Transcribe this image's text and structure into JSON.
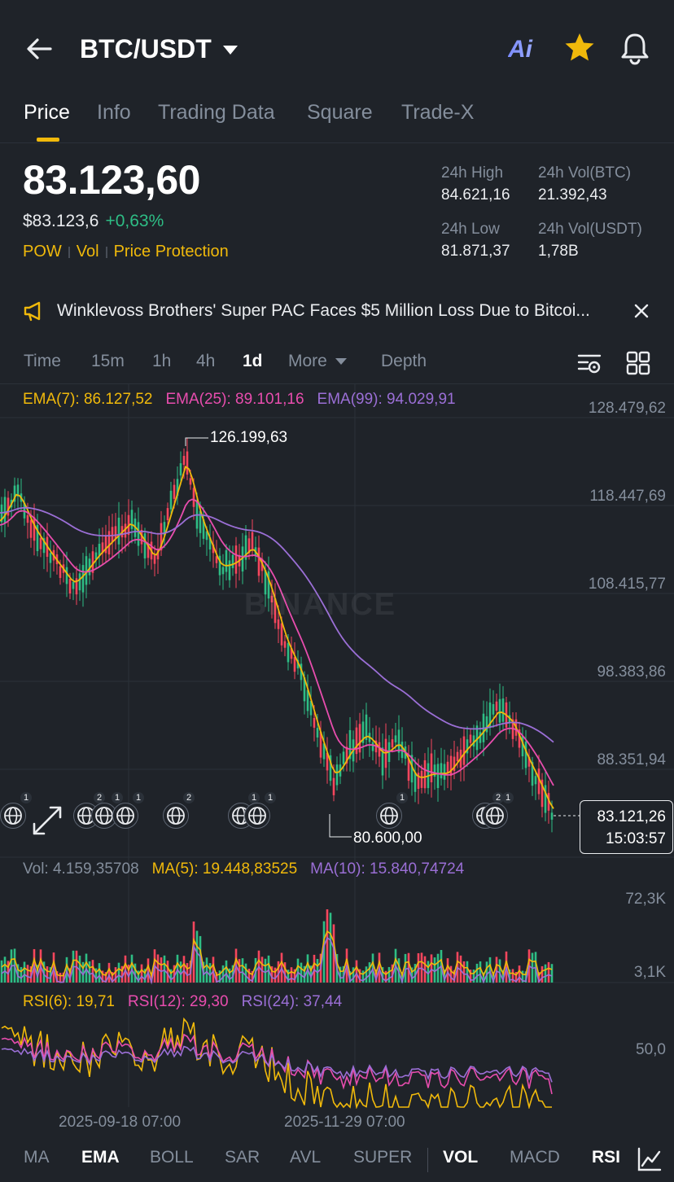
{
  "header": {
    "pair": "BTC/USDT",
    "icons": [
      "back-arrow-icon",
      "ai-icon",
      "star-icon",
      "bell-icon"
    ],
    "ai_label": "Ai"
  },
  "tabs": [
    {
      "label": "Price",
      "active": true
    },
    {
      "label": "Info",
      "active": false
    },
    {
      "label": "Trading Data",
      "active": false
    },
    {
      "label": "Square",
      "active": false
    },
    {
      "label": "Trade-X",
      "active": false
    }
  ],
  "summary": {
    "price": "83.123,60",
    "fiat": "$83.123,6",
    "change": "+0,63%",
    "badges": [
      "POW",
      "Vol",
      "Price Protection"
    ],
    "stats": {
      "high_label": "24h High",
      "high": "84.621,16",
      "volbtc_label": "24h Vol(BTC)",
      "volbtc": "21.392,43",
      "low_label": "24h Low",
      "low": "81.871,37",
      "volusdt_label": "24h Vol(USDT)",
      "volusdt": "1,78B"
    }
  },
  "news": {
    "text": "Winklevoss Brothers' Super PAC Faces $5 Million Loss Due to Bitcoi..."
  },
  "intervals": {
    "items": [
      "Time",
      "15m",
      "1h",
      "4h",
      "1d",
      "More",
      "Depth"
    ],
    "active": "1d"
  },
  "legend": {
    "ema7": "EMA(7): 86.127,52",
    "ema25": "EMA(25): 89.101,16",
    "ema99": "EMA(99): 94.029,91",
    "vol": "Vol: 4.159,35708",
    "ma5": "MA(5): 19.448,83525",
    "ma10": "MA(10): 15.840,74724",
    "rsi6": "RSI(6): 19,71",
    "rsi12": "RSI(12): 29,30",
    "rsi24": "RSI(24): 37,44"
  },
  "chart_data": {
    "type": "candlestick",
    "price_axis": [
      "128.479,62",
      "118.447,69",
      "108.415,77",
      "98.383,86",
      "88.351,94"
    ],
    "volume_axis": [
      "72,3K",
      "3,1K"
    ],
    "rsi_axis": [
      "50,0"
    ],
    "x_labels": [
      "2025-09-18 07:00",
      "2025-11-29 07:00"
    ],
    "high_marker": "126.199,63",
    "low_marker": "80.600,00",
    "last_price": "83.121,26",
    "countdown": "15:03:57",
    "watermark": "BINANCE",
    "colors": {
      "up": "#2ebd85",
      "down": "#f6465d",
      "ema7": "#f0b90b",
      "ema25": "#e84dae",
      "ema99": "#9b6fd6"
    }
  },
  "news_markers": [
    "1",
    "2",
    "1",
    "1",
    "2",
    "1",
    "1",
    "1",
    "2",
    "1"
  ],
  "indicators": {
    "items": [
      "MA",
      "EMA",
      "BOLL",
      "SAR",
      "AVL",
      "SUPER",
      "VOL",
      "MACD",
      "RSI"
    ],
    "active": [
      "EMA",
      "VOL",
      "RSI"
    ]
  }
}
